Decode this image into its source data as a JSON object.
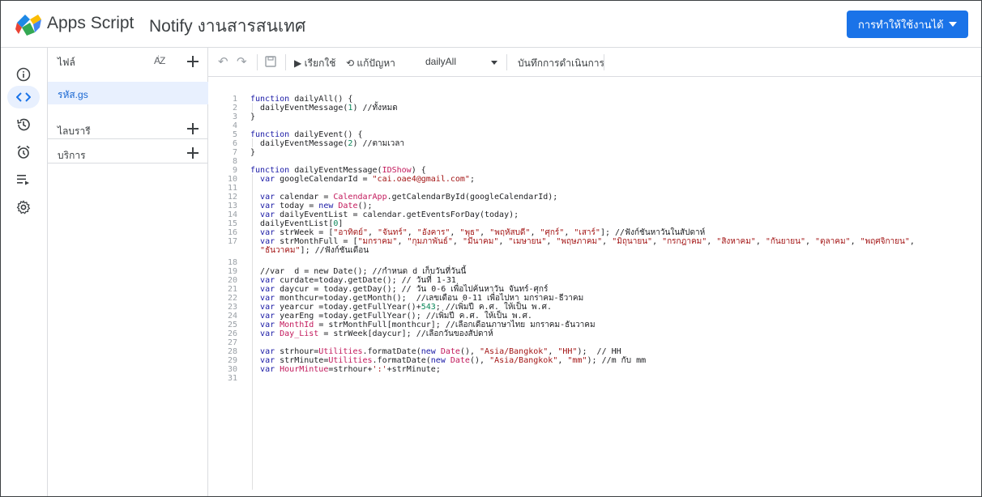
{
  "header": {
    "app_name": "Apps Script",
    "project_title": "Notify งานสารสนเทศ",
    "deploy_label": "การทำให้ใช้งานได้"
  },
  "rail": {
    "icons": [
      "info-icon",
      "code-icon",
      "history-icon",
      "alarm-icon",
      "executions-icon",
      "settings-icon"
    ]
  },
  "files": {
    "label": "ไฟล์",
    "sort_label": "AZ",
    "items": [
      {
        "name": "รหัส.gs"
      }
    ],
    "sections": [
      {
        "label": "ไลบรารี"
      },
      {
        "label": "บริการ"
      }
    ]
  },
  "toolbar": {
    "run_label": "เรียกใช้",
    "debug_label": "แก้ปัญหา",
    "function_name": "dailyAll",
    "log_label": "บันทึกการดำเนินการ"
  },
  "editor": {
    "lines": [
      {
        "n": "1",
        "text": "function dailyAll() {"
      },
      {
        "n": "2",
        "text": "  dailyEventMessage(1) //ทั้งหมด"
      },
      {
        "n": "3",
        "text": "}"
      },
      {
        "n": "4",
        "text": ""
      },
      {
        "n": "5",
        "text": "function dailyEvent() {"
      },
      {
        "n": "6",
        "text": "  dailyEventMessage(2) //ตามเวลา"
      },
      {
        "n": "7",
        "text": "}"
      },
      {
        "n": "8",
        "text": ""
      },
      {
        "n": "9",
        "text": "function dailyEventMessage(IDShow) {"
      },
      {
        "n": "10",
        "text": "  var googleCalendarId = \"cai.oae4@gmail.com\";"
      },
      {
        "n": "11",
        "text": ""
      },
      {
        "n": "12",
        "text": "  var calendar = CalendarApp.getCalendarById(googleCalendarId);"
      },
      {
        "n": "13",
        "text": "  var today = new Date();"
      },
      {
        "n": "14",
        "text": "  var dailyEventList = calendar.getEventsForDay(today);"
      },
      {
        "n": "15",
        "text": "  dailyEventList[0]"
      },
      {
        "n": "16",
        "text": "  var strWeek = [\"อาทิตย์\", \"จันทร์\", \"อังคาร\", \"พุธ\", \"พฤหัสบดี\", \"ศุกร์\", \"เสาร์\"]; //ฟังก์ชันหาวันในสัปดาห์"
      },
      {
        "n": "17",
        "text": "  var strMonthFull = [\"มกราคม\", \"กุมภาพันธ์\", \"มีนาคม\", \"เมษายน\", \"พฤษภาคม\", \"มิถุนายน\", \"กรกฎาคม\", \"สิงหาคม\", \"กันยายน\", \"ตุลาคม\", \"พฤศจิกายน\","
      },
      {
        "n": "",
        "text": "  \"ธันวาคม\"]; //ฟังก์ชันเดือน"
      },
      {
        "n": "18",
        "text": ""
      },
      {
        "n": "19",
        "text": "  //var  d = new Date(); //กำหนด d เก็บวันที่วันนี้"
      },
      {
        "n": "20",
        "text": "  var curdate=today.getDate(); // วันที่ 1-31"
      },
      {
        "n": "21",
        "text": "  var daycur = today.getDay(); // วัน 0-6 เพื่อไปค้นหาวัน จันทร์-ศุกร์"
      },
      {
        "n": "22",
        "text": "  var monthcur=today.getMonth();  //เลขเดือน 0-11 เพื่อไปหา มกราคม-ธีวาคม"
      },
      {
        "n": "23",
        "text": "  var yearcur =today.getFullYear()+543; //เพิ่มปี ค.ศ. ให้เป็น พ.ศ."
      },
      {
        "n": "24",
        "text": "  var yearEng =today.getFullYear(); //เพิ่มปี ค.ศ. ให้เป็น พ.ศ."
      },
      {
        "n": "25",
        "text": "  var MonthId = strMonthFull[monthcur]; //เลือกเดือนภาษาไทย มกราคม-ธันวาคม"
      },
      {
        "n": "26",
        "text": "  var Day_List = strWeek[daycur]; //เลือกวันของสัปดาห์"
      },
      {
        "n": "27",
        "text": ""
      },
      {
        "n": "28",
        "text": "  var strhour=Utilities.formatDate(new Date(), \"Asia/Bangkok\", \"HH\");  // HH"
      },
      {
        "n": "29",
        "text": "  var strMinute=Utilities.formatDate(new Date(), \"Asia/Bangkok\", \"mm\"); //m กับ mm"
      },
      {
        "n": "30",
        "text": "  var HourMintue=strhour+':'+strMinute;"
      },
      {
        "n": "31",
        "text": ""
      }
    ]
  },
  "colors": {
    "accent": "#1a73e8",
    "selected_bg": "#e8f0fe",
    "keyword": "#1a1aa6",
    "string": "#a31515",
    "number": "#098658"
  }
}
